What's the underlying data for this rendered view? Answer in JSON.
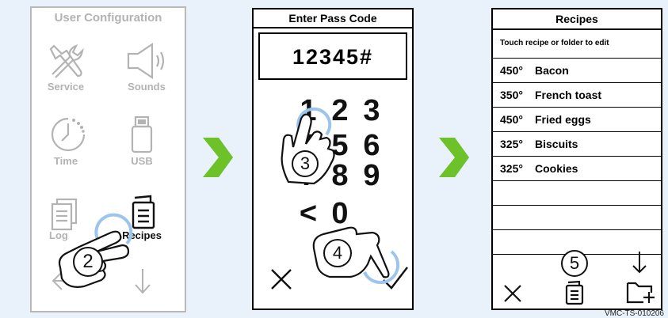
{
  "panel1": {
    "title": "User Configuration",
    "items": [
      {
        "label": "Service",
        "icon": "service-tools-icon"
      },
      {
        "label": "Sounds",
        "icon": "speaker-icon"
      },
      {
        "label": "Time",
        "icon": "clock-icon"
      },
      {
        "label": "USB",
        "icon": "usb-drive-icon"
      },
      {
        "label": "Log",
        "icon": "log-document-icon"
      },
      {
        "label": "Recipes",
        "icon": "recipe-book-icon"
      }
    ],
    "step": "2"
  },
  "panel2": {
    "title": "Enter Pass Code",
    "code": "12345#",
    "keys": [
      "1",
      "2",
      "3",
      "4",
      "5",
      "6",
      "7",
      "8",
      "9",
      "<",
      "0"
    ],
    "step_press": "3",
    "step_confirm": "4"
  },
  "panel3": {
    "title": "Recipes",
    "subtitle": "Touch recipe or folder to edit",
    "recipes": [
      {
        "temp": "450°",
        "name": "Bacon"
      },
      {
        "temp": "350°",
        "name": "French toast"
      },
      {
        "temp": "450°",
        "name": "Fried eggs"
      },
      {
        "temp": "325°",
        "name": "Biscuits"
      },
      {
        "temp": "325°",
        "name": "Cookies"
      }
    ],
    "step": "5"
  },
  "credit": "VMC-TS-010206",
  "colors": {
    "arrow": "#6cc228",
    "highlight": "#9cc4ec",
    "muted": "#b3b3b3"
  }
}
